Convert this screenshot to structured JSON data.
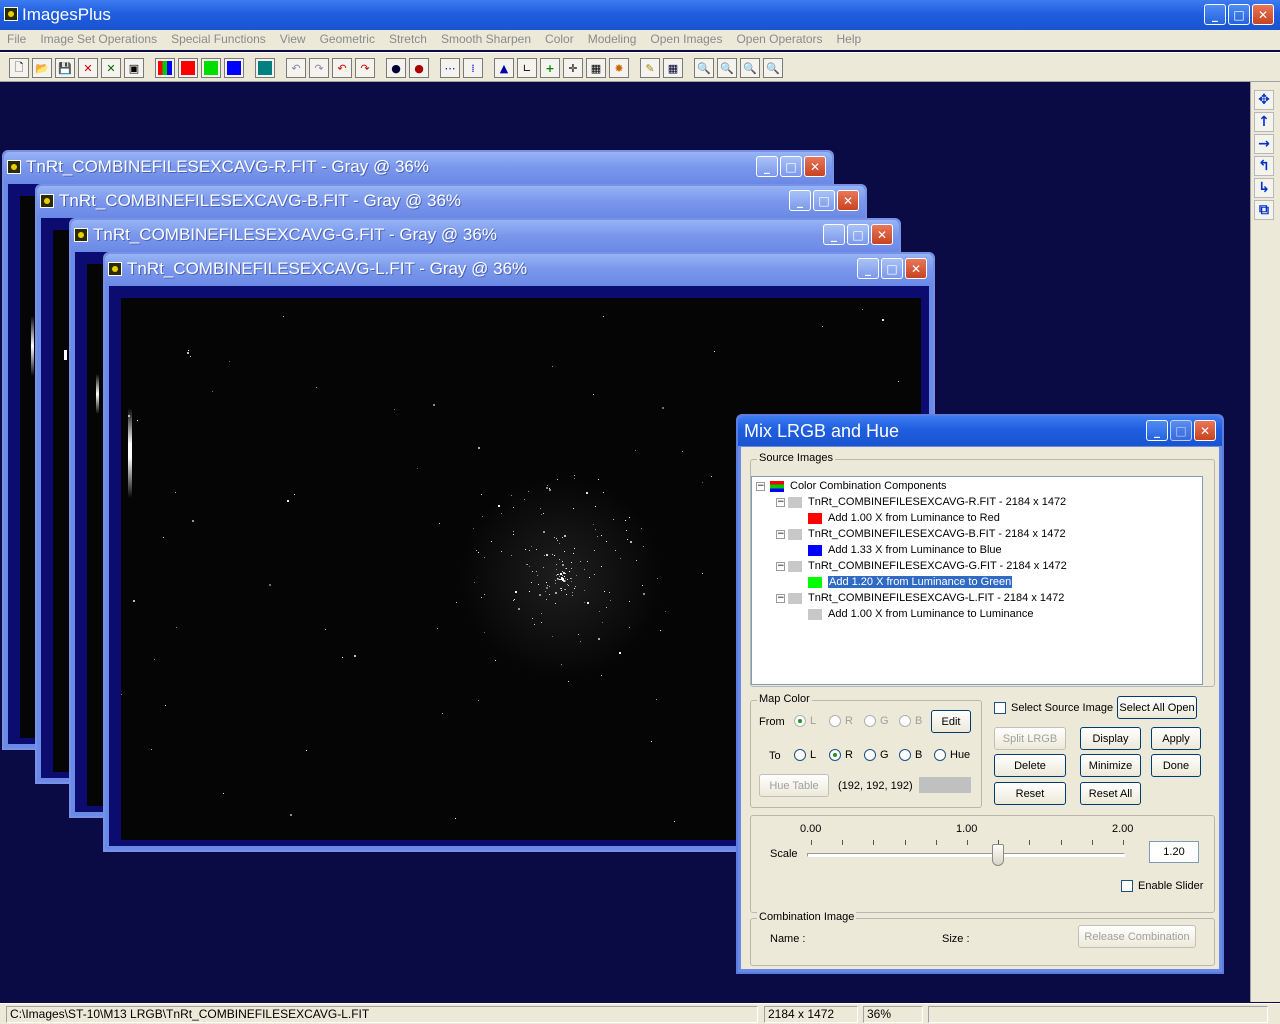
{
  "app": {
    "title": "ImagesPlus"
  },
  "menu": [
    "File",
    "Image Set Operations",
    "Special Functions",
    "View",
    "Geometric",
    "Stretch",
    "Smooth Sharpen",
    "Color",
    "Modeling",
    "Open Images",
    "Open Operators",
    "Help"
  ],
  "toolbar": {
    "icons": [
      "new-file-icon",
      "open-folder-icon",
      "save-icon",
      "close-x-icon",
      "close-all-icon",
      "copy-window-icon",
      "rgb-icon",
      "red-channel-icon",
      "green-channel-icon",
      "blue-channel-icon",
      "grid-icon",
      "undo-icon",
      "redo-icon",
      "undo-red-icon",
      "redo-red-icon",
      "record-icon",
      "stop-icon",
      "dots-icon",
      "pixel-icon",
      "histogram-icon",
      "curve-icon",
      "plus-icon",
      "crosshair-icon",
      "calculator-icon",
      "palette-icon",
      "pencil-icon",
      "table-icon",
      "zoom-in-icon",
      "zoom-out-icon",
      "zoom-fit-icon",
      "zoom-actual-icon"
    ],
    "colors": {
      "red": "#ff0000",
      "green": "#00dd00",
      "blue": "#0000ff",
      "teal": "#008080"
    }
  },
  "image_windows": [
    {
      "title": "TnRt_COMBINEFILESEXCAVG-R.FIT - Gray @ 36%"
    },
    {
      "title": "TnRt_COMBINEFILESEXCAVG-B.FIT - Gray @ 36%"
    },
    {
      "title": "TnRt_COMBINEFILESEXCAVG-G.FIT - Gray @ 36%"
    },
    {
      "title": "TnRt_COMBINEFILESEXCAVG-L.FIT - Gray @ 36%"
    }
  ],
  "dialog": {
    "title": "Mix LRGB and Hue",
    "source_images_label": "Source Images",
    "tree": {
      "root": "Color Combination Components",
      "items": [
        {
          "file": "TnRt_COMBINEFILESEXCAVG-R.FIT - 2184 x 1472",
          "action": "Add 1.00 X from Luminance to Red",
          "color": "#ff0000"
        },
        {
          "file": "TnRt_COMBINEFILESEXCAVG-B.FIT - 2184 x 1472",
          "action": "Add 1.33 X from Luminance to Blue",
          "color": "#0000ff"
        },
        {
          "file": "TnRt_COMBINEFILESEXCAVG-G.FIT - 2184 x 1472",
          "action": "Add 1.20 X from Luminance to Green",
          "color": "#00ff00"
        },
        {
          "file": "TnRt_COMBINEFILESEXCAVG-L.FIT - 2184 x 1472",
          "action": "Add 1.00 X from Luminance to Luminance",
          "color": "#c8c8c8"
        }
      ]
    },
    "map_color": {
      "label": "Map Color",
      "from_label": "From",
      "to_label": "To",
      "from_options": [
        "L",
        "R",
        "G",
        "B"
      ],
      "to_options": [
        "L",
        "R",
        "G",
        "B",
        "Hue"
      ],
      "from_selected": "L",
      "to_selected": "R",
      "edit": "Edit",
      "hue_table": "Hue Table",
      "rgb_value": "(192, 192, 192)",
      "swatch_color": "#c0c0c0"
    },
    "select_source_image": "Select Source Image",
    "buttons": {
      "select_all_open": "Select All Open",
      "split_lrgb": "Split LRGB",
      "display": "Display",
      "apply": "Apply",
      "delete": "Delete",
      "minimize": "Minimize",
      "done": "Done",
      "reset": "Reset",
      "reset_all": "Reset All",
      "release_combination": "Release Combination"
    },
    "scale": {
      "label": "Scale",
      "ticks": [
        "0.00",
        "1.00",
        "2.00"
      ],
      "value": "1.20",
      "min": 0,
      "max": 2,
      "current": 1.2
    },
    "enable_slider": "Enable Slider",
    "combination": {
      "label": "Combination Image",
      "name_label": "Name :",
      "size_label": "Size :"
    }
  },
  "status": {
    "path": "C:\\Images\\ST-10\\M13 LRGB\\TnRt_COMBINEFILESEXCAVG-L.FIT",
    "dimensions": "2184 x 1472",
    "zoom": "36%"
  }
}
